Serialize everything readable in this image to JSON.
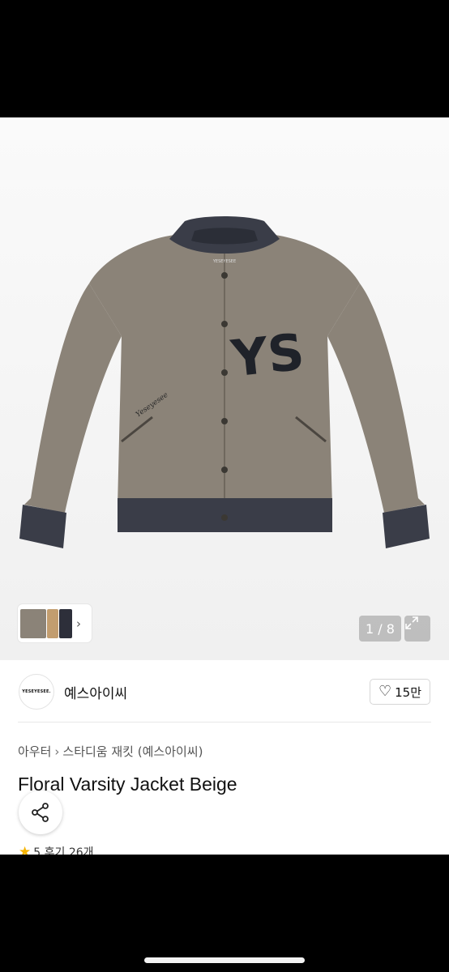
{
  "gallery": {
    "pager": "1 / 8",
    "thumbnails": [
      "thumbnail-beige",
      "thumbnail-tan",
      "thumbnail-navy"
    ],
    "jacket_patch_text": "YS",
    "jacket_label_text": "YESEYESEE",
    "jacket_script_text": "Yeseyesee",
    "icons": {
      "expand": "expand-icon",
      "chevron": "chevron-right-icon"
    }
  },
  "brand": {
    "logo_text": "YESEYESEE.",
    "name": "예스아이씨",
    "likes": "15만"
  },
  "breadcrumb": {
    "category": "아우터",
    "subcategory": "스타디움 재킷 (예스아이씨)"
  },
  "product": {
    "title": "Floral Varsity Jacket Beige",
    "rating": "5",
    "reviews": "후기 26개"
  },
  "colors": {
    "jacket_body": "#8b8378",
    "rib": "#3a3d48",
    "patch": "#1f2229",
    "star": "#f5b301"
  }
}
